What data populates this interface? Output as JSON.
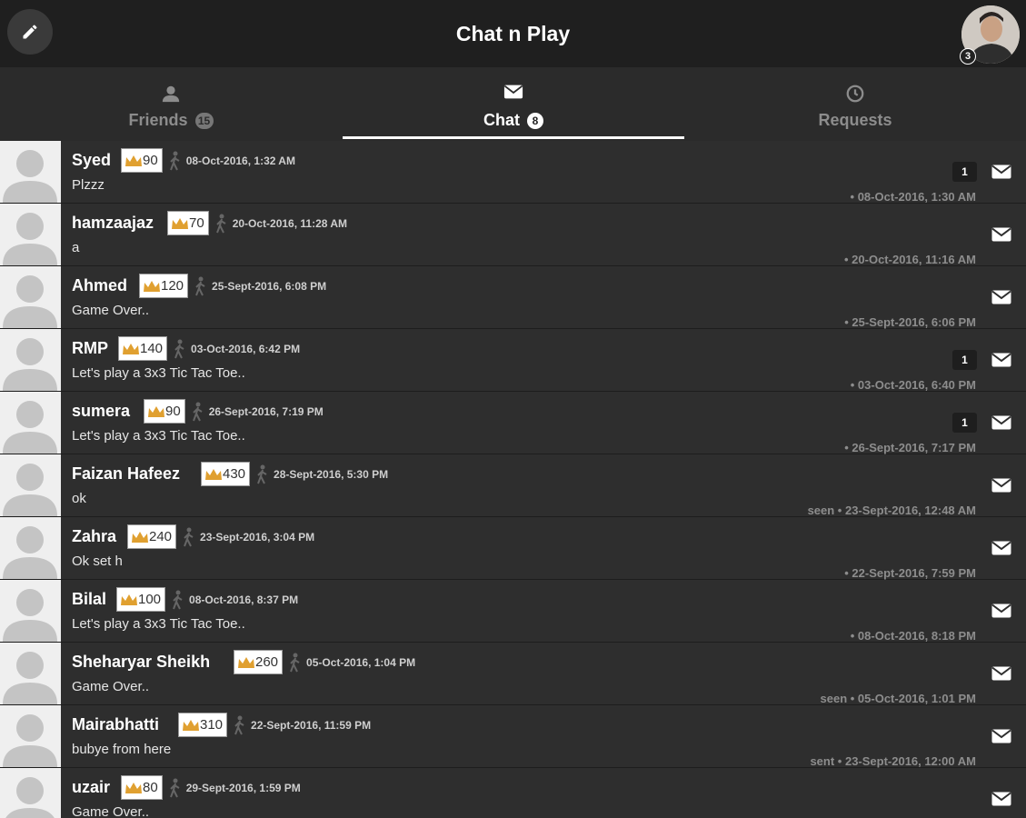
{
  "header": {
    "title": "Chat n Play",
    "profile_badge": "3"
  },
  "tabs": [
    {
      "label": "Friends",
      "count": "15",
      "icon": "person-icon",
      "active": false
    },
    {
      "label": "Chat",
      "count": "8",
      "icon": "envelope-icon",
      "active": true
    },
    {
      "label": "Requests",
      "count": "",
      "icon": "clock-icon",
      "active": false
    }
  ],
  "chats": [
    {
      "name": "Syed",
      "score": "90",
      "last_active": "08-Oct-2016, 1:32 AM",
      "preview": "Plzzz",
      "unread": "1",
      "time": "• 08-Oct-2016, 1:30 AM"
    },
    {
      "name": "hamzaajaz",
      "score": "70",
      "last_active": "20-Oct-2016, 11:28 AM",
      "preview": "a",
      "unread": "",
      "time": "• 20-Oct-2016, 11:16 AM"
    },
    {
      "name": "Ahmed",
      "score": "120",
      "last_active": "25-Sept-2016, 6:08 PM",
      "preview": "Game Over..",
      "unread": "",
      "time": "• 25-Sept-2016, 6:06 PM"
    },
    {
      "name": "RMP",
      "score": "140",
      "last_active": "03-Oct-2016, 6:42 PM",
      "preview": "Let's play a 3x3 Tic Tac Toe..",
      "unread": "1",
      "time": "• 03-Oct-2016, 6:40 PM"
    },
    {
      "name": "sumera",
      "score": "90",
      "last_active": "26-Sept-2016, 7:19 PM",
      "preview": "Let's play a 3x3 Tic Tac Toe..",
      "unread": "1",
      "time": "• 26-Sept-2016, 7:17 PM"
    },
    {
      "name": "Faizan Hafeez",
      "score": "430",
      "last_active": "28-Sept-2016, 5:30 PM",
      "preview": "ok",
      "unread": "",
      "time": "seen • 23-Sept-2016, 12:48 AM"
    },
    {
      "name": "Zahra",
      "score": "240",
      "last_active": "23-Sept-2016, 3:04 PM",
      "preview": "Ok set h",
      "unread": "",
      "time": "• 22-Sept-2016, 7:59 PM"
    },
    {
      "name": "Bilal",
      "score": "100",
      "last_active": "08-Oct-2016, 8:37 PM",
      "preview": "Let's play a 3x3 Tic Tac Toe..",
      "unread": "",
      "time": "• 08-Oct-2016, 8:18 PM"
    },
    {
      "name": "Sheharyar Sheikh",
      "score": "260",
      "last_active": "05-Oct-2016, 1:04 PM",
      "preview": "Game Over..",
      "unread": "",
      "time": "seen • 05-Oct-2016, 1:01 PM"
    },
    {
      "name": "Mairabhatti",
      "score": "310",
      "last_active": "22-Sept-2016, 11:59 PM",
      "preview": "bubye from here",
      "unread": "",
      "time": "sent • 23-Sept-2016, 12:00 AM"
    },
    {
      "name": "uzair",
      "score": "80",
      "last_active": "29-Sept-2016, 1:59 PM",
      "preview": "Game Over..",
      "unread": "",
      "time": ""
    }
  ],
  "colors": {
    "background": "#2b2b2b",
    "header": "#1f1f1f",
    "row": "#2e2e2e",
    "crown": "#e0a030"
  }
}
